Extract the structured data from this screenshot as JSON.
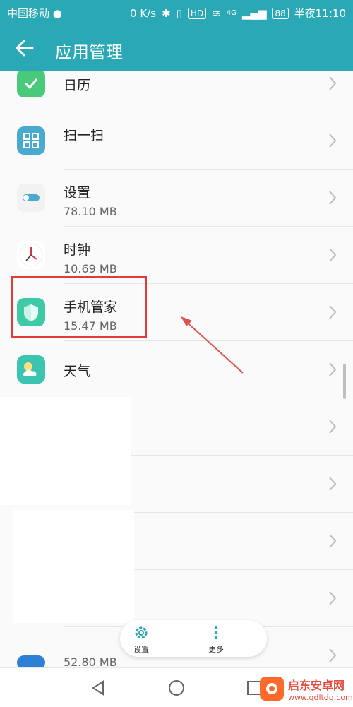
{
  "status_bar": {
    "carrier": "中国移动",
    "speed": "0 K/s",
    "hd": "HD",
    "net": "4G",
    "battery": "88",
    "time": "半夜11:10"
  },
  "app_bar": {
    "title": "应用管理"
  },
  "apps": [
    {
      "name": "日历",
      "size": ""
    },
    {
      "name": "扫一扫",
      "size": ""
    },
    {
      "name": "设置",
      "size": "78.10 MB"
    },
    {
      "name": "时钟",
      "size": "10.69 MB"
    },
    {
      "name": "手机管家",
      "size": "15.47 MB"
    },
    {
      "name": "天气",
      "size": ""
    },
    {
      "name": "",
      "size": ""
    },
    {
      "name": "",
      "size": ""
    },
    {
      "name": "",
      "size": ""
    },
    {
      "name": "",
      "size": ""
    },
    {
      "name": "",
      "size": "52.80 MB"
    }
  ],
  "floating_bar": {
    "settings_label": "设置",
    "more_label": "更多"
  },
  "watermark": {
    "title": "启东安卓网",
    "url": "www.qdltdq.com"
  },
  "colors": {
    "primary": "#2aa8b5",
    "highlight": "#e23b3b"
  }
}
